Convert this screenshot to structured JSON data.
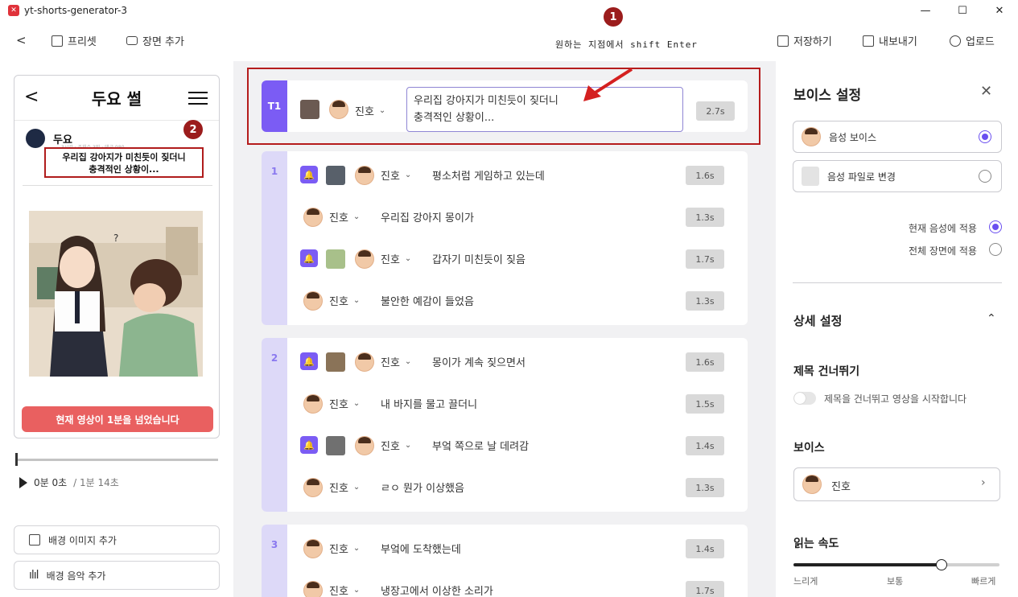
{
  "window": {
    "title": "yt-shorts-generator-3",
    "minimize": "—",
    "maximize": "☐",
    "close": "✕"
  },
  "toolbar": {
    "back": "<",
    "preset": "프리셋",
    "add_scene": "장면 추가",
    "hint": "원하는 지점에서 shift Enter",
    "save": "저장하기",
    "export": "내보내기",
    "upload": "업로드"
  },
  "annotations": {
    "badge1": "1",
    "badge2": "2"
  },
  "preview": {
    "header_title": "두요 썰",
    "author": "두요",
    "meta": "3시간 · 조회수 3만 · 댓글 980",
    "title_line1": "우리집 강아지가 미친듯이 짖더니",
    "title_line2": "충격적인 상황이...",
    "overflow_warning": "현재 영상이 1분을 넘었습니다",
    "time_current": "0분 0초",
    "time_total": "/ 1분 14초",
    "add_bg_image": "배경 이미지 추가",
    "add_bg_music": "배경 음악 추가"
  },
  "script": {
    "title_row": {
      "tag": "T1",
      "voice": "진호",
      "text": "우리집 강아지가 미친듯이 짖더니\n충격적인 상황이...",
      "duration": "2.7s"
    },
    "groups": [
      {
        "index": "1",
        "lines": [
          {
            "voice": "진호",
            "text": "평소처럼 게임하고 있는데",
            "duration": "1.6s",
            "media": true
          },
          {
            "voice": "진호",
            "text": "우리집 강아지 몽이가",
            "duration": "1.3s",
            "media": false
          },
          {
            "voice": "진호",
            "text": "갑자기 미친듯이 짖음",
            "duration": "1.7s",
            "media": true
          },
          {
            "voice": "진호",
            "text": "불안한 예감이 들었음",
            "duration": "1.3s",
            "media": false
          }
        ]
      },
      {
        "index": "2",
        "lines": [
          {
            "voice": "진호",
            "text": "몽이가 계속 짖으면서",
            "duration": "1.6s",
            "media": true
          },
          {
            "voice": "진호",
            "text": "내 바지를 물고 끌더니",
            "duration": "1.5s",
            "media": false
          },
          {
            "voice": "진호",
            "text": "부엌 쪽으로 날 데려감",
            "duration": "1.4s",
            "media": true
          },
          {
            "voice": "진호",
            "text": "ㄹㅇ 뭔가 이상했음",
            "duration": "1.3s",
            "media": false
          }
        ]
      },
      {
        "index": "3",
        "lines": [
          {
            "voice": "진호",
            "text": "부엌에 도착했는데",
            "duration": "1.4s",
            "media": false
          },
          {
            "voice": "진호",
            "text": "냉장고에서 이상한 소리가",
            "duration": "1.7s",
            "media": false
          }
        ]
      }
    ]
  },
  "voice_panel": {
    "title": "보이스 설정",
    "option_voice": "음성 보이스",
    "option_file": "음성 파일로 변경",
    "apply_current": "현재 음성에 적용",
    "apply_all": "전체 장면에 적용",
    "detail_title": "상세 설정",
    "skip_title": "제목 건너뛰기",
    "skip_desc": "제목을 건너뛰고 영상을 시작합니다",
    "voice_label": "보이스",
    "voice_selected": "진호",
    "speed_label": "읽는 속도",
    "speed_slow": "느리게",
    "speed_normal": "보통",
    "speed_fast": "빠르게",
    "speed_value": 0.72
  },
  "colors": {
    "accent": "#7b5cf4",
    "warning": "#e96060",
    "annotation": "#b51c1c"
  }
}
